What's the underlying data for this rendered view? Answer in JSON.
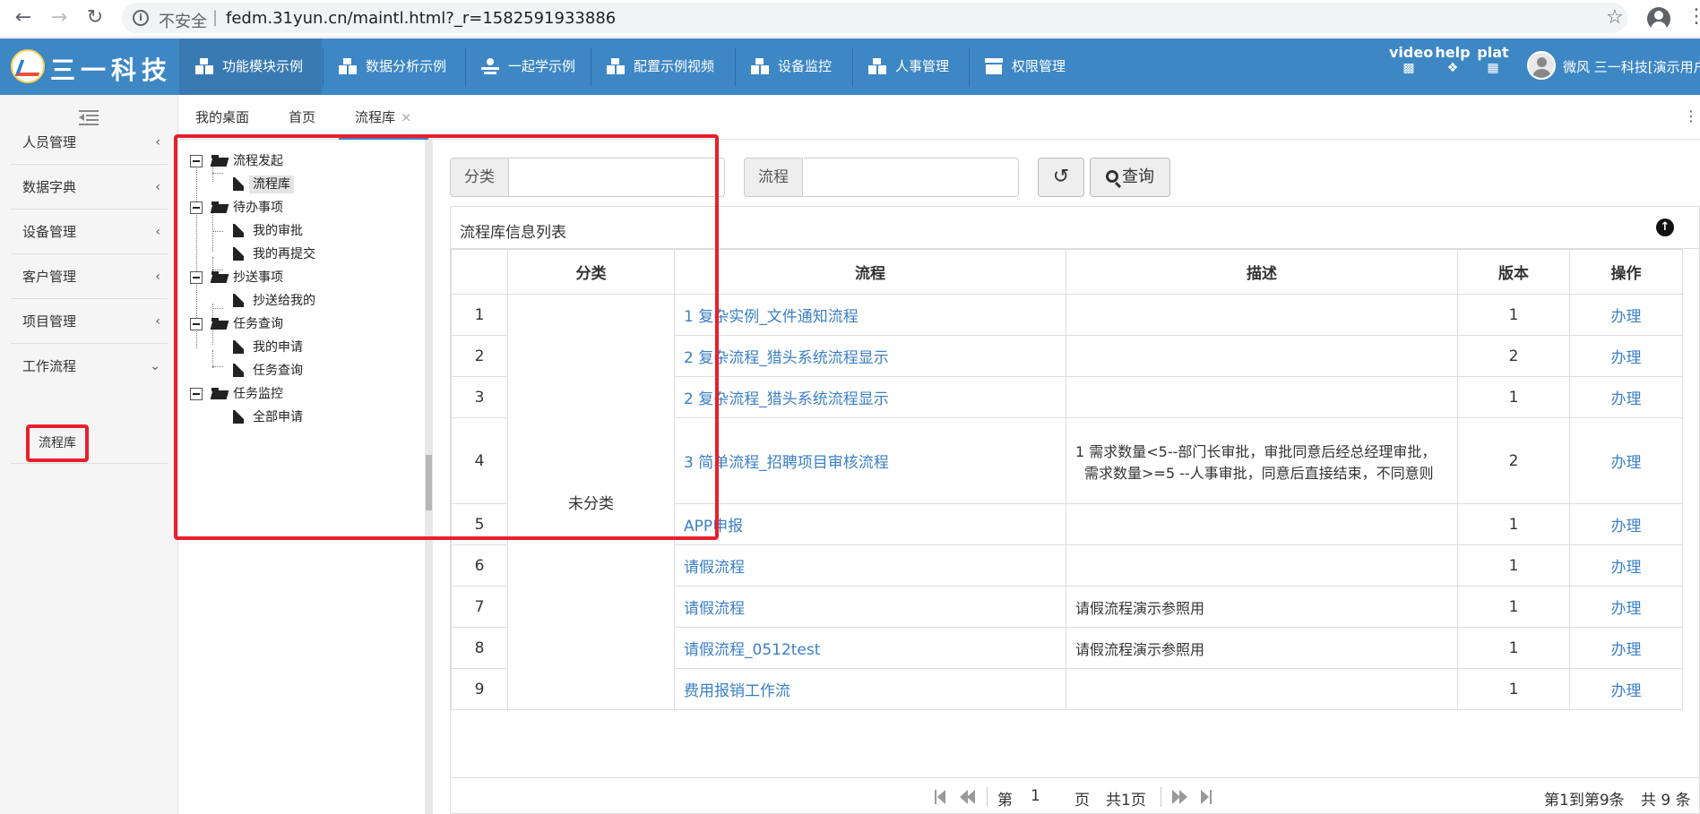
{
  "browser": {
    "security_label": "不安全",
    "separator": "|",
    "url": "fedm.31yun.cn/maintl.html?_r=1582591933886"
  },
  "header": {
    "brand": "三一科技",
    "nav": [
      {
        "label": "功能模块示例",
        "icon": "modules-icon"
      },
      {
        "label": "数据分析示例",
        "icon": "modules-icon"
      },
      {
        "label": "一起学示例",
        "icon": "learn-icon"
      },
      {
        "label": "配置示例视频",
        "icon": "modules-icon"
      },
      {
        "label": "设备监控",
        "icon": "modules-icon"
      },
      {
        "label": "人事管理",
        "icon": "modules-icon"
      },
      {
        "label": "权限管理",
        "icon": "box-icon"
      }
    ],
    "quick": [
      {
        "label": "video",
        "icon": "video-camera-icon"
      },
      {
        "label": "help",
        "icon": "handshake-icon"
      },
      {
        "label": "plat",
        "icon": "platform-icon"
      }
    ],
    "user": "微风 三一科技[演示用户"
  },
  "sidebar": {
    "items": [
      {
        "label": "人员管理",
        "chevron": "‹"
      },
      {
        "label": "数据字典",
        "chevron": "‹"
      },
      {
        "label": "设备管理",
        "chevron": "‹"
      },
      {
        "label": "客户管理",
        "chevron": "‹"
      },
      {
        "label": "项目管理",
        "chevron": "‹"
      },
      {
        "label": "工作流程",
        "chevron": "⌄"
      }
    ],
    "active_child": "流程库"
  },
  "tabs": [
    {
      "label": "我的桌面"
    },
    {
      "label": "首页"
    },
    {
      "label": "流程库",
      "close": "×"
    }
  ],
  "tree": {
    "groups": [
      {
        "label": "流程发起",
        "children": [
          "流程库"
        ]
      },
      {
        "label": "待办事项",
        "children": [
          "我的审批",
          "我的再提交"
        ]
      },
      {
        "label": "抄送事项",
        "children": [
          "抄送给我的"
        ]
      },
      {
        "label": "任务查询",
        "children": [
          "我的申请",
          "任务查询"
        ]
      },
      {
        "label": "任务监控",
        "children": [
          "全部申请"
        ]
      }
    ]
  },
  "search": {
    "category_label": "分类",
    "category_value": "",
    "flow_label": "流程",
    "flow_value": "",
    "refresh_icon": "↺",
    "query_label": "查询"
  },
  "grid": {
    "title": "流程库信息列表",
    "collapse_icon": "↑",
    "columns": [
      "",
      "分类",
      "流程",
      "描述",
      "版本",
      "操作"
    ],
    "category_merged": "未分类",
    "rows": [
      {
        "num": "1",
        "flow": "1 复杂实例_文件通知流程",
        "desc": "",
        "desc2": "",
        "version": "1",
        "action": "办理"
      },
      {
        "num": "2",
        "flow": "2 复杂流程_猎头系统流程显示",
        "desc": "",
        "desc2": "",
        "version": "2",
        "action": "办理"
      },
      {
        "num": "3",
        "flow": "2 复杂流程_猎头系统流程显示",
        "desc": "",
        "desc2": "",
        "version": "1",
        "action": "办理"
      },
      {
        "num": "4",
        "flow": "3 简单流程_招聘项目审核流程",
        "desc": "1 需求数量<5--部门长审批，审批同意后经总经理审批，",
        "desc2": "需求数量>=5 --人事审批，同意后直接结束，不同意则",
        "version": "2",
        "action": "办理"
      },
      {
        "num": "5",
        "flow": "APP申报",
        "desc": "",
        "desc2": "",
        "version": "1",
        "action": "办理"
      },
      {
        "num": "6",
        "flow": "请假流程",
        "desc": "",
        "desc2": "",
        "version": "1",
        "action": "办理"
      },
      {
        "num": "7",
        "flow": "请假流程",
        "desc": "请假流程演示参照用",
        "desc2": "",
        "version": "1",
        "action": "办理"
      },
      {
        "num": "8",
        "flow": "请假流程_0512test",
        "desc": "请假流程演示参照用",
        "desc2": "",
        "version": "1",
        "action": "办理"
      },
      {
        "num": "9",
        "flow": "费用报销工作流",
        "desc": "",
        "desc2": "",
        "version": "1",
        "action": "办理"
      }
    ]
  },
  "pager": {
    "page_prefix": "第",
    "page_value": "1",
    "page_suffix": "页",
    "total_pages": "共1页",
    "range": "第1到第9条",
    "total": "共 9 条"
  }
}
